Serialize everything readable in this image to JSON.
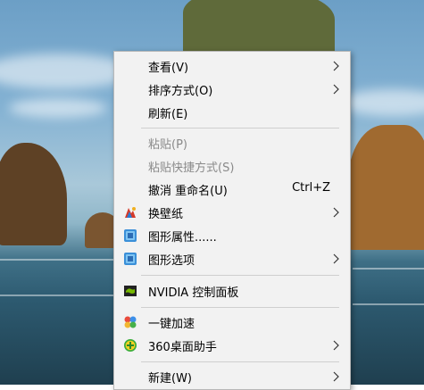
{
  "menu": {
    "items": [
      {
        "id": "view",
        "label": "查看(V)",
        "submenu": true,
        "disabled": false,
        "icon": null
      },
      {
        "id": "sort",
        "label": "排序方式(O)",
        "submenu": true,
        "disabled": false,
        "icon": null
      },
      {
        "id": "refresh",
        "label": "刷新(E)",
        "submenu": false,
        "disabled": false,
        "icon": null
      },
      {
        "id": "paste",
        "label": "粘贴(P)",
        "submenu": false,
        "disabled": true,
        "icon": null
      },
      {
        "id": "paste-shortcut",
        "label": "粘贴快捷方式(S)",
        "submenu": false,
        "disabled": true,
        "icon": null
      },
      {
        "id": "undo-rename",
        "label": "撤消 重命名(U)",
        "shortcut": "Ctrl+Z",
        "submenu": false,
        "disabled": false,
        "icon": null
      },
      {
        "id": "change-wallpaper",
        "label": "换壁纸",
        "submenu": true,
        "disabled": false,
        "icon": "wallpaper-icon"
      },
      {
        "id": "graphics-properties",
        "label": "图形属性......",
        "submenu": false,
        "disabled": false,
        "icon": "intel-graphics-icon"
      },
      {
        "id": "graphics-options",
        "label": "图形选项",
        "submenu": true,
        "disabled": false,
        "icon": "intel-graphics-icon"
      },
      {
        "id": "nvidia-control-panel",
        "label": "NVIDIA 控制面板",
        "submenu": false,
        "disabled": false,
        "icon": "nvidia-icon"
      },
      {
        "id": "one-click-boost",
        "label": "一键加速",
        "submenu": false,
        "disabled": false,
        "icon": "speedup-icon"
      },
      {
        "id": "360-desktop-assistant",
        "label": "360桌面助手",
        "submenu": true,
        "disabled": false,
        "icon": "360-plus-icon"
      },
      {
        "id": "new",
        "label": "新建(W)",
        "submenu": true,
        "disabled": false,
        "icon": null
      }
    ]
  },
  "colors": {
    "menu_bg": "#f2f2f2",
    "disabled_text": "#8a8a8a",
    "separator": "#cfcfcf"
  }
}
